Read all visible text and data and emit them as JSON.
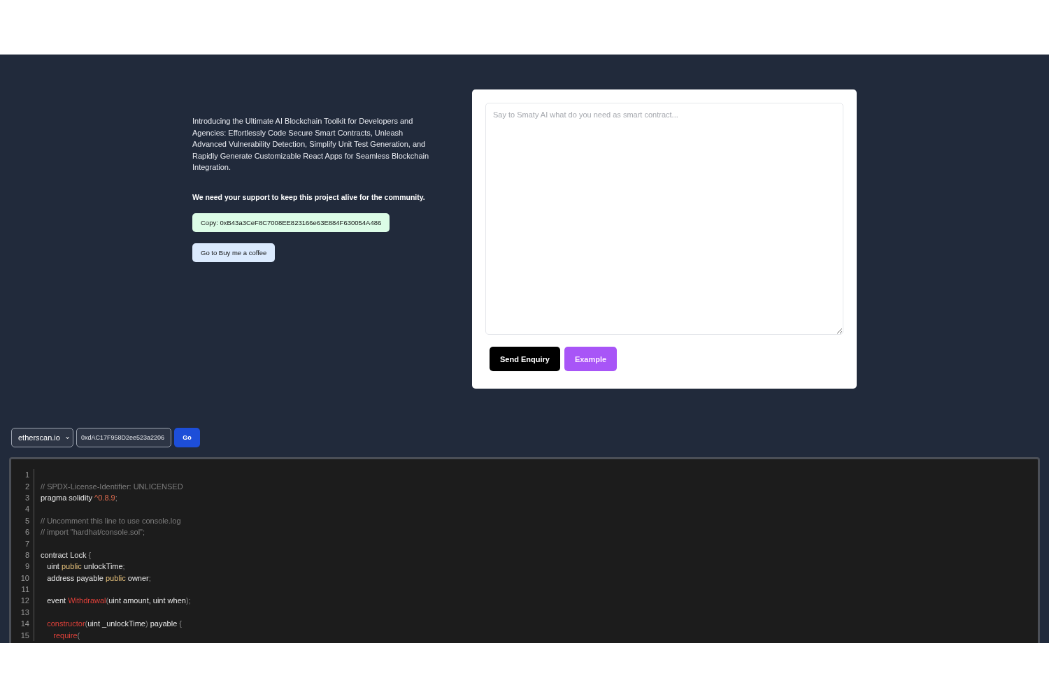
{
  "intro": {
    "description": "Introducing the Ultimate AI Blockchain Toolkit for Developers and Agencies: Effortlessly Code Secure Smart Contracts, Unleash Advanced Vulnerability Detection, Simplify Unit Test Generation, and Rapidly Generate Customizable React Apps for Seamless Blockchain Integration.",
    "support": "We need your support to keep this project alive for the community.",
    "copy_button": "Copy: 0xB43a3CeF8C7008EE823166e63E884F630054A486",
    "coffee_button": "Go to Buy me a coffee"
  },
  "enquiry": {
    "placeholder": "Say to Smaty AI what do you need as smart contract...",
    "buttons": [
      {
        "label": "Send Enquiry",
        "kind": "primary"
      },
      {
        "label": "Example",
        "kind": "accent"
      }
    ]
  },
  "loader": {
    "explorer": "etherscan.io",
    "address": "0xdAC17F958D2ee523a2206",
    "go": "Go"
  },
  "editor": {
    "lines": [
      {
        "number": "1"
      },
      {
        "number": "2",
        "tokens": [
          {
            "kind": "comment",
            "text": "// SPDX-License-Identifier: UNLICENSED"
          }
        ]
      },
      {
        "number": "3",
        "tokens": [
          {
            "kind": "plain",
            "text": "pragma solidity "
          },
          {
            "kind": "number",
            "text": "^0.8.9"
          },
          {
            "kind": "punct",
            "text": ";"
          }
        ]
      },
      {
        "number": "4"
      },
      {
        "number": "5",
        "tokens": [
          {
            "kind": "comment",
            "text": "// Uncomment this line to use console.log"
          }
        ]
      },
      {
        "number": "6",
        "tokens": [
          {
            "kind": "comment",
            "text": "// import \"hardhat/console.sol\";"
          }
        ]
      },
      {
        "number": "7"
      },
      {
        "number": "8",
        "tokens": [
          {
            "kind": "plain",
            "text": "contract Lock "
          },
          {
            "kind": "punct",
            "text": "{"
          }
        ]
      },
      {
        "number": "9",
        "tokens": [
          {
            "kind": "plain",
            "text": "   uint "
          },
          {
            "kind": "keyword",
            "text": "public"
          },
          {
            "kind": "plain",
            "text": " unlockTime"
          },
          {
            "kind": "punct",
            "text": ";"
          }
        ]
      },
      {
        "number": "10",
        "tokens": [
          {
            "kind": "plain",
            "text": "   address payable "
          },
          {
            "kind": "keyword",
            "text": "public"
          },
          {
            "kind": "plain",
            "text": " owner"
          },
          {
            "kind": "punct",
            "text": ";"
          }
        ]
      },
      {
        "number": "11"
      },
      {
        "number": "12",
        "tokens": [
          {
            "kind": "plain",
            "text": "   event "
          },
          {
            "kind": "function",
            "text": "Withdrawal"
          },
          {
            "kind": "punct",
            "text": "("
          },
          {
            "kind": "plain",
            "text": "uint amount, uint when"
          },
          {
            "kind": "punct",
            "text": ");"
          }
        ]
      },
      {
        "number": "13"
      },
      {
        "number": "14",
        "tokens": [
          {
            "kind": "function",
            "text": "   constructor"
          },
          {
            "kind": "punct",
            "text": "("
          },
          {
            "kind": "plain",
            "text": "uint _unlockTime"
          },
          {
            "kind": "punct",
            "text": ")"
          },
          {
            "kind": "plain",
            "text": " payable "
          },
          {
            "kind": "punct",
            "text": "{"
          }
        ]
      },
      {
        "number": "15",
        "tokens": [
          {
            "kind": "function",
            "text": "      require"
          },
          {
            "kind": "punct",
            "text": "("
          }
        ]
      }
    ]
  }
}
